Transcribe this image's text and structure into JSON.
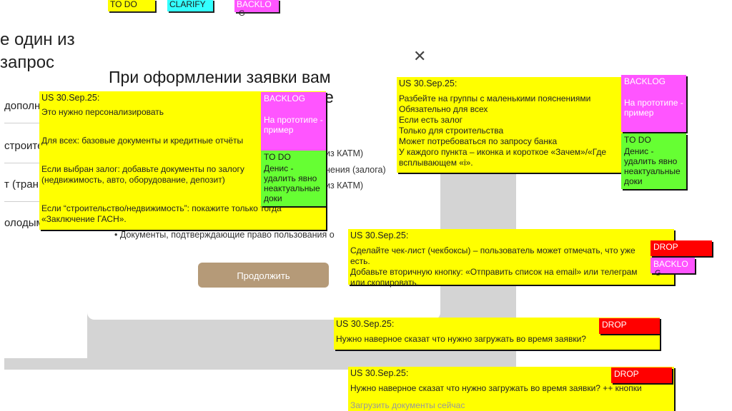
{
  "legend": {
    "todo": "TO DO",
    "clarify": "CLARIFY",
    "backlog_line1": "BACKLO",
    "backlog_line2": "G"
  },
  "background": {
    "heading_line1": "е один из",
    "heading_line2": "запрос",
    "rows": [
      "дополн",
      "строите",
      "т (тран",
      "олодым"
    ]
  },
  "modal": {
    "title_line1": "При оформлении заявки вам",
    "title_line2": "е",
    "bullets": [
      "из КАТМ)",
      "нения (залога)",
      "из КАТМ)",
      "• Документы, подтверждающие право пользования о"
    ],
    "continue_button": "Продолжить"
  },
  "notes": {
    "n1": {
      "head": "US 30.Sep.25:",
      "lines": [
        "Это нужно персонализировать",
        "Для всех: базовые документы и кредитные отчёты",
        "Если выбран залог: добавьте документы по залогу",
        "(недвижимость, авто, оборудование, депозит)",
        "Если “строительство/недвижимость”: покажите только тогда",
        "«Заключение ГАСН»."
      ],
      "backlog": "BACKLOG",
      "backlog_text": "На прототипе - пример",
      "todo": "TO DO",
      "todo_text": "Денис - удалить явно неактуальные доки"
    },
    "n2": {
      "head": "US 30.Sep.25:",
      "lines": [
        "Разбейте на группы с маленькими пояснениями",
        "Обязательно для всех",
        "Если есть залог",
        "Только для строительства",
        "Может потребоваться по запросу банка",
        "У каждого пункта – иконка и короткое «Зачем»/«Где",
        "всплывающем «i»."
      ],
      "backlog": "BACKLOG",
      "backlog_text": "На прототипе - пример",
      "todo": "TO DO",
      "todo_text": "Денис - удалить явно неактуальные доки"
    },
    "n3": {
      "head": "US 30.Sep.25:",
      "lines": [
        "Сделайте чек-лист (чекбоксы) – пользователь может отмечать, что уже",
        "есть.",
        "Добавьте вторичную кнопку: «Отправить список на email» или телеграм",
        "или скопировать."
      ],
      "drop": "DROP",
      "backlog": "BACKLO",
      "backlog2": "G"
    },
    "n4": {
      "head": "US 30.Sep.25:",
      "line": "Нужно наверное сказат что нужно загружать во время заявки?",
      "drop": "DROP"
    },
    "n5": {
      "head": "US 30.Sep.25:",
      "line": "Нужно наверное сказат что нужно загружать во время заявки? ++ кнопки",
      "line2": "Загрузить документы сейчас",
      "drop": "DROP"
    }
  }
}
